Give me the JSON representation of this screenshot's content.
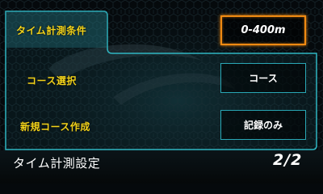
{
  "settings": {
    "rows": [
      {
        "label": "タイム計測条件",
        "value": "0-400m",
        "selected": true
      },
      {
        "label": "コース選択",
        "value": "コース",
        "selected": false
      },
      {
        "label": "新規コース作成",
        "value": "記録のみ",
        "selected": false
      }
    ]
  },
  "footer": {
    "title": "タイム計測設定",
    "page": "2/2"
  },
  "colors": {
    "label_yellow": "#f2d21a",
    "accent_cyan": "#29a7b5",
    "selected_orange": "#f08a12"
  }
}
